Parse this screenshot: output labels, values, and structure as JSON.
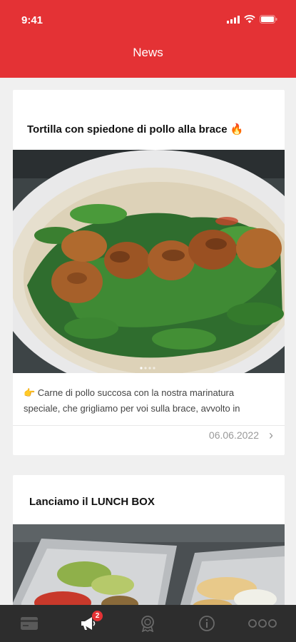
{
  "status_bar": {
    "time": "9:41"
  },
  "header": {
    "title": "News"
  },
  "posts": [
    {
      "title": "Tortilla con spiedone di pollo alla brace 🔥",
      "image": "tortilla-chicken-skewer-photo",
      "text_line1": "👉 Carne di pollo succosa con la nostra marinatura",
      "text_line2": "speciale, che grigliamo per voi sulla brace, avvolto in",
      "date": "06.06.2022"
    },
    {
      "title": "Lanciamo il LUNCH BOX",
      "image": "lunch-box-trays-photo"
    }
  ],
  "tabbar": {
    "badge_count": "2",
    "items": [
      "card-icon",
      "megaphone-icon",
      "award-icon",
      "info-icon",
      "more-icon"
    ]
  },
  "colors": {
    "accent": "#e43235",
    "tabbar_bg": "#2d2d2d"
  }
}
